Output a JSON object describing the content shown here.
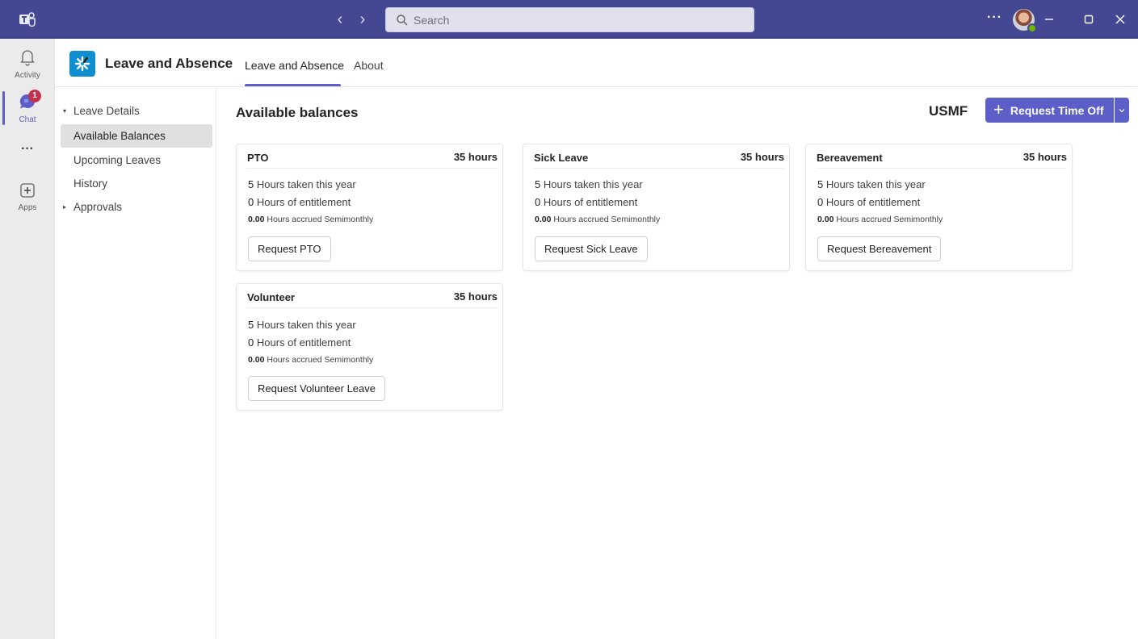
{
  "titlebar": {
    "search_placeholder": "Search",
    "more_label": "···",
    "colors": {
      "bar": "#444791",
      "presence": "#6bb700"
    }
  },
  "rail": {
    "items": [
      {
        "id": "activity",
        "label": "Activity",
        "icon": "bell-icon"
      },
      {
        "id": "chat",
        "label": "Chat",
        "icon": "chat-icon",
        "badge": "1",
        "active": true
      },
      {
        "id": "more",
        "label": "···",
        "icon": "more-icon"
      },
      {
        "id": "apps",
        "label": "Apps",
        "icon": "apps-icon"
      }
    ]
  },
  "app": {
    "title": "Leave and Absence",
    "tabs": [
      {
        "label": "Leave and Absence",
        "active": true
      },
      {
        "label": "About",
        "active": false
      }
    ],
    "accent": "#5b5fc7"
  },
  "nav": {
    "items": [
      {
        "label": "Leave Details",
        "caret": "▾",
        "expanded": true
      },
      {
        "label": "Available Balances",
        "selected": true
      },
      {
        "label": "Upcoming Leaves"
      },
      {
        "label": "History"
      },
      {
        "label": "Approvals",
        "caret": "▸",
        "expanded": false
      }
    ]
  },
  "content": {
    "title": "Available balances",
    "company": "USMF",
    "request_button": "Request Time Off",
    "cards": [
      {
        "title": "PTO",
        "hours": "35 hours",
        "taken_value": "5",
        "taken_label": "Hours taken this year",
        "entitlement_value": "0",
        "entitlement_label": "Hours of entitlement",
        "accrued_value": "0.00",
        "accrued_label": "Hours accrued Semimonthly",
        "button": "Request PTO"
      },
      {
        "title": "Sick Leave",
        "hours": "35 hours",
        "taken_value": "5",
        "taken_label": "Hours taken this year",
        "entitlement_value": "0",
        "entitlement_label": "Hours of entitlement",
        "accrued_value": "0.00",
        "accrued_label": "Hours accrued Semimonthly",
        "button": "Request Sick Leave"
      },
      {
        "title": "Bereavement",
        "hours": "35 hours",
        "taken_value": "5",
        "taken_label": "Hours taken this year",
        "entitlement_value": "0",
        "entitlement_label": "Hours of entitlement",
        "accrued_value": "0.00",
        "accrued_label": "Hours accrued Semimonthly",
        "button": "Request Bereavement"
      },
      {
        "title": "Volunteer",
        "hours": "35 hours",
        "taken_value": "5",
        "taken_label": "Hours taken this year",
        "entitlement_value": "0",
        "entitlement_label": "Hours of entitlement",
        "accrued_value": "0.00",
        "accrued_label": "Hours accrued Semimonthly",
        "button": "Request Volunteer Leave"
      }
    ]
  }
}
